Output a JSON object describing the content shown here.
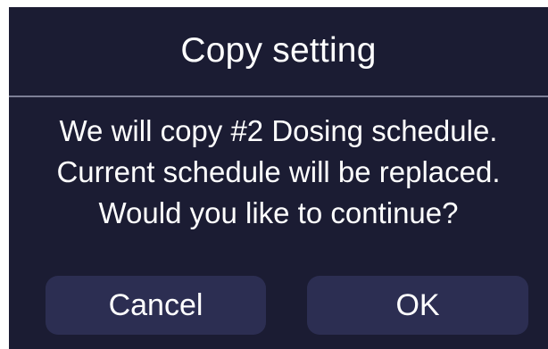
{
  "dialog": {
    "title": "Copy setting",
    "message_lines": [
      "We will copy #2 Dosing schedule.",
      "Current schedule will be replaced.",
      "Would you like to continue?"
    ],
    "cancel_label": "Cancel",
    "ok_label": "OK"
  },
  "colors": {
    "dialog_background": "#1b1c33",
    "button_background": "#2c2e52",
    "divider": "#7d7f96",
    "text": "#ffffff"
  }
}
